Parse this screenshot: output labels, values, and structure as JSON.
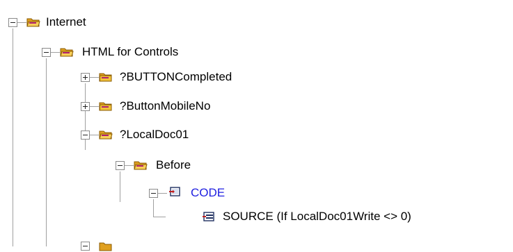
{
  "tree": {
    "nodes": [
      {
        "label": "Internet",
        "icon": "folder-open-icon",
        "state": "expanded"
      },
      {
        "label": "HTML for Controls",
        "icon": "folder-open-icon",
        "state": "expanded"
      },
      {
        "label": "?BUTTONCompleted",
        "icon": "folder-closed-icon",
        "state": "collapsed"
      },
      {
        "label": "?ButtonMobileNo",
        "icon": "folder-closed-icon",
        "state": "collapsed"
      },
      {
        "label": "?LocalDoc01",
        "icon": "folder-open-icon",
        "state": "expanded"
      },
      {
        "label": "Before",
        "icon": "folder-open-icon",
        "state": "expanded"
      },
      {
        "label": "CODE",
        "icon": "code-block-icon",
        "state": "expanded",
        "color": "#1f1fe0"
      },
      {
        "label": "SOURCE (If LocalDoc01Write <> 0)",
        "icon": "source-line-icon",
        "state": "leaf"
      }
    ]
  }
}
